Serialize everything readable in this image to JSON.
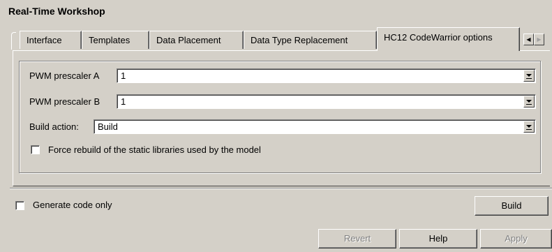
{
  "header": {
    "title": "Real-Time Workshop"
  },
  "tabs": [
    {
      "label": "Interface",
      "active": false
    },
    {
      "label": "Templates",
      "active": false
    },
    {
      "label": "Data Placement",
      "active": false
    },
    {
      "label": "Data Type Replacement",
      "active": false
    },
    {
      "label": "HC12 CodeWarrior options",
      "active": true
    }
  ],
  "tab_scroll": {
    "left_icon": "triangle-left",
    "right_icon": "triangle-right"
  },
  "options": {
    "pwm_a": {
      "label": "PWM prescaler A",
      "value": "1"
    },
    "pwm_b": {
      "label": "PWM prescaler B",
      "value": "1"
    },
    "build_action": {
      "label": "Build action:",
      "value": "Build"
    },
    "force_rebuild": {
      "label": "Force rebuild of the static libraries used by the model",
      "checked": false
    }
  },
  "generate_code_only": {
    "label": "Generate code only",
    "checked": false
  },
  "buttons": {
    "build": "Build",
    "revert": "Revert",
    "help": "Help",
    "apply": "Apply"
  },
  "colors": {
    "face": "#d4d0c8",
    "highlight": "#ffffff",
    "shadow": "#808080",
    "dark_shadow": "#404040",
    "disabled_text": "#808080"
  }
}
